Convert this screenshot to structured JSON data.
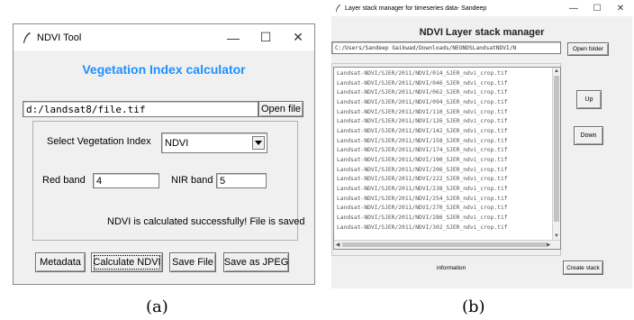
{
  "window_a": {
    "title": "NDVI Tool",
    "heading": "Vegetation Index calculator",
    "file_path": "d:/landsat8/file.tif",
    "open_file_label": "Open file",
    "select_label": "Select Vegetation Index",
    "index_value": "NDVI",
    "red_label": "Red band",
    "red_value": "4",
    "nir_label": "NIR band",
    "nir_value": "5",
    "status": "NDVI is calculated successfully! File is saved",
    "buttons": [
      "Metadata",
      "Calculate NDVI",
      "Save File",
      "Save as JPEG"
    ],
    "heading_color": "#1e90ff"
  },
  "window_b": {
    "title": "Layer stack manager for timeseries data- Sandeep",
    "heading": "NDVI Layer stack manager",
    "folder_path": "C:/Users/Sandeep Gaikwad/Downloads/NEONDSLandsatNDVI/N",
    "open_folder_label": "Open folder",
    "files": [
      "Landsat-NDVI/SJER/2011/NDVI/014_SJER_ndvi_crop.tif",
      "Landsat-NDVI/SJER/2011/NDVI/046_SJER_ndvi_crop.tif",
      "Landsat-NDVI/SJER/2011/NDVI/062_SJER_ndvi_crop.tif",
      "Landsat-NDVI/SJER/2011/NDVI/094_SJER_ndvi_crop.tif",
      "Landsat-NDVI/SJER/2011/NDVI/110_SJER_ndvi_crop.tif",
      "Landsat-NDVI/SJER/2011/NDVI/126_SJER_ndvi_crop.tif",
      "Landsat-NDVI/SJER/2011/NDVI/142_SJER_ndvi_crop.tif",
      "Landsat-NDVI/SJER/2011/NDVI/158_SJER_ndvi_crop.tif",
      "Landsat-NDVI/SJER/2011/NDVI/174_SJER_ndvi_crop.tif",
      "Landsat-NDVI/SJER/2011/NDVI/190_SJER_ndvi_crop.tif",
      "Landsat-NDVI/SJER/2011/NDVI/206_SJER_ndvi_crop.tif",
      "Landsat-NDVI/SJER/2011/NDVI/222_SJER_ndvi_crop.tif",
      "Landsat-NDVI/SJER/2011/NDVI/238_SJER_ndvi_crop.tif",
      "Landsat-NDVI/SJER/2011/NDVI/254_SJER_ndvi_crop.tif",
      "Landsat-NDVI/SJER/2011/NDVI/270_SJER_ndvi_crop.tif",
      "Landsat-NDVI/SJER/2011/NDVI/286_SJER_ndvi_crop.tif",
      "Landsat-NDVI/SJER/2011/NDVI/302_SJER_ndvi_crop.tif"
    ],
    "up_label": "Up",
    "down_label": "Down",
    "info_label": "information",
    "create_stack_label": "Create stack"
  },
  "captions": {
    "a": "(a)",
    "b": "(b)"
  },
  "icons": {
    "window_icon": "feather-icon",
    "minimize": "minimize-icon",
    "maximize": "maximize-icon",
    "close": "close-icon",
    "dropdown": "chevron-down-icon"
  }
}
